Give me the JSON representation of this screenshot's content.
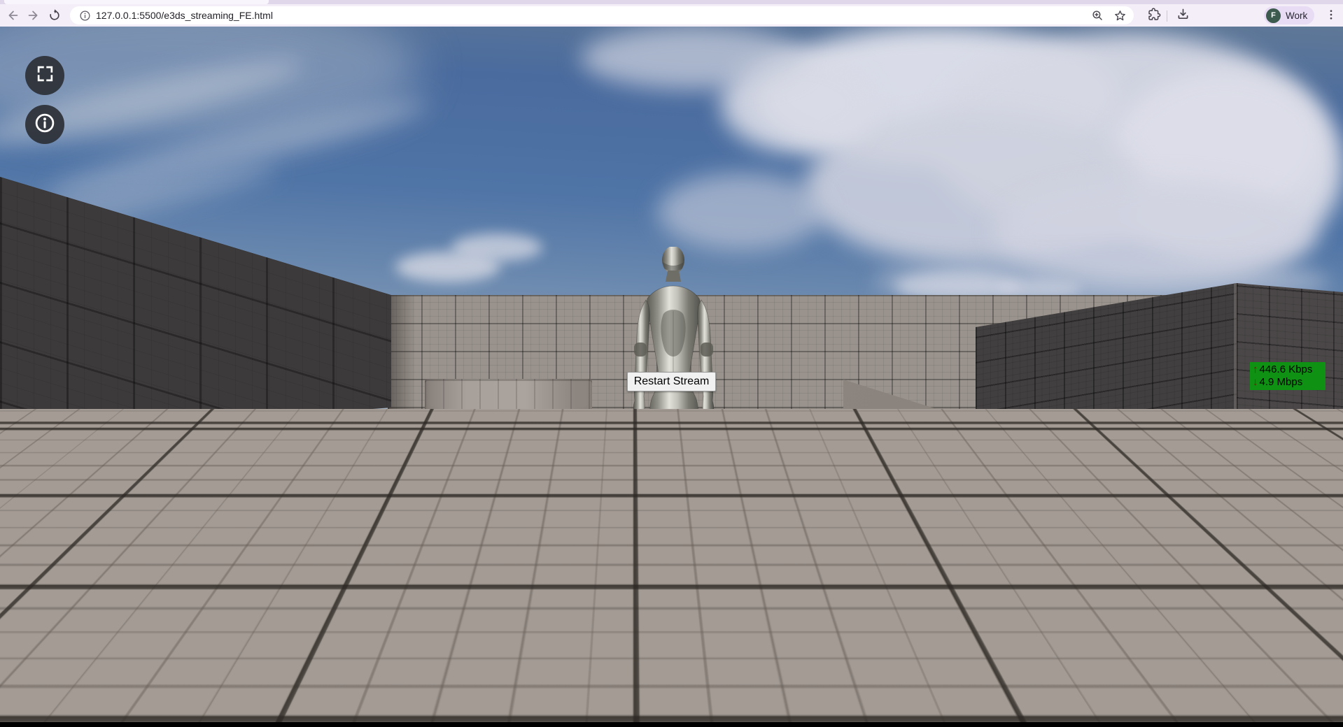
{
  "browser": {
    "toolbar": {
      "url": "127.0.0.1:5500/e3ds_streaming_FE.html",
      "profile": {
        "initial": "F",
        "label": "Work"
      },
      "icons": {
        "back": "arrow-left",
        "forward": "arrow-right",
        "reload": "reload-circular-arrow",
        "site_info": "info-circle",
        "zoom": "magnifier-plus",
        "bookmark": "star-outline",
        "extensions": "puzzle-piece",
        "downloads": "download-tray",
        "profile_avatar": "letter-avatar",
        "menu": "kebab-vertical"
      },
      "colors": {
        "toolbar_bg": "#f4eef8",
        "address_bar_bg": "#ffffff",
        "profile_chip_bg": "#e7dcf4",
        "avatar_bg": "#3c5a4e"
      }
    }
  },
  "stream": {
    "restart_button": {
      "label": "Restart Stream"
    },
    "stats_badge": {
      "upload_arrow": "↑",
      "upload_value": "446.6 Kbps",
      "download_arrow": "↓",
      "download_value": "4.9 Mbps",
      "bg_color": "#0f9213",
      "arrow_color": "#7a140c",
      "text_color": "#000000"
    },
    "overlays": {
      "fullscreen_icon": "fullscreen-corner-brackets",
      "info_icon": "info-circle",
      "wifi_icon": "wifi-signal",
      "wifi_color": "#17e617",
      "button_bg": "rgba(42,46,51,0.9)"
    },
    "scene_colors": {
      "sky_blue": "#4a6ea6",
      "cloud_white": "#d6d8e3",
      "wall_light": "#9a938d",
      "wall_dark": "#3d3a3b",
      "floor": "#a39b94",
      "character_metal": "#b9b9b1"
    }
  }
}
